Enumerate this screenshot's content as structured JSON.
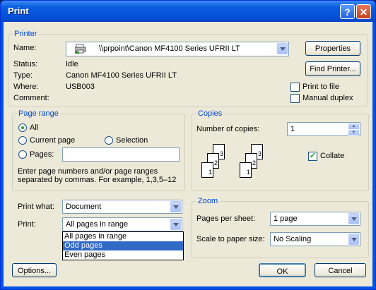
{
  "window": {
    "title": "Print",
    "help_glyph": "?",
    "close_glyph": "✕"
  },
  "printer": {
    "group_label": "Printer",
    "name_label": "Name:",
    "name_value": "\\\\prpoint\\Canon MF4100 Series UFRII LT",
    "status_label": "Status:",
    "status_value": "Idle",
    "type_label": "Type:",
    "type_value": "Canon MF4100 Series UFRII LT",
    "where_label": "Where:",
    "where_value": "USB003",
    "comment_label": "Comment:",
    "properties_button": "Properties",
    "find_printer_button": "Find Printer...",
    "print_to_file_label": "Print to file",
    "manual_duplex_label": "Manual duplex",
    "print_to_file_checked": false,
    "manual_duplex_checked": false
  },
  "page_range": {
    "group_label": "Page range",
    "all_label": "All",
    "current_page_label": "Current page",
    "selection_label": "Selection",
    "pages_label": "Pages:",
    "selected": "All",
    "pages_value": "",
    "hint_line1": "Enter page numbers and/or page ranges",
    "hint_line2": "separated by commas.  For example, 1,3,5–12"
  },
  "copies": {
    "group_label": "Copies",
    "number_label": "Number of copies:",
    "number_value": "1",
    "collate_label": "Collate",
    "collate_checked": true,
    "stack_pages": [
      "3",
      "2",
      "1"
    ]
  },
  "print_what": {
    "label": "Print what:",
    "value": "Document"
  },
  "print": {
    "label": "Print:",
    "value": "All pages in range",
    "options": [
      "All pages in range",
      "Odd pages",
      "Even pages"
    ],
    "highlighted": "Odd pages"
  },
  "zoom": {
    "group_label": "Zoom",
    "pages_per_sheet_label": "Pages per sheet:",
    "pages_per_sheet_value": "1 page",
    "scale_label": "Scale to paper size:",
    "scale_value": "No Scaling"
  },
  "buttons": {
    "options": "Options...",
    "ok": "OK",
    "cancel": "Cancel"
  }
}
